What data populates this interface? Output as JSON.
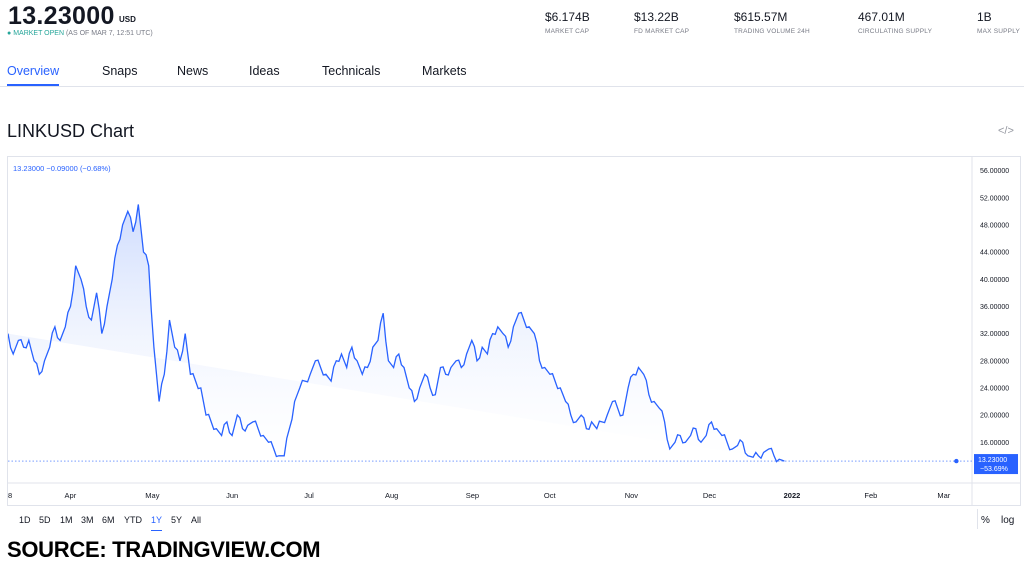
{
  "header": {
    "price": "13.23000",
    "currency": "USD",
    "status_dot": "●",
    "status_open": "MARKET OPEN",
    "status_time": "(AS OF MAR 7, 12:51 UTC)",
    "stats": [
      {
        "value": "$6.174B",
        "label": "MARKET CAP"
      },
      {
        "value": "$13.22B",
        "label": "FD MARKET CAP"
      },
      {
        "value": "$615.57M",
        "label": "TRADING VOLUME 24H"
      },
      {
        "value": "467.01M",
        "label": "CIRCULATING SUPPLY"
      },
      {
        "value": "1B",
        "label": "MAX SUPPLY"
      }
    ]
  },
  "tabs": [
    "Overview",
    "Snaps",
    "News",
    "Ideas",
    "Technicals",
    "Markets"
  ],
  "active_tab": "Overview",
  "chart_title": "LINKUSD Chart",
  "embed_icon": "code-icon",
  "embed_glyph": "</>",
  "chart_data": {
    "type": "area",
    "legend": "13.23000  −0.09000 (−0.68%)",
    "last_value_label": "13.23000",
    "last_change_label": "−53.69%",
    "line_color": "#2962ff",
    "fill_color": "#e3ebff",
    "ylim": [
      10,
      58
    ],
    "y_ticks": [
      "56.00000",
      "52.00000",
      "48.00000",
      "44.00000",
      "40.00000",
      "36.00000",
      "32.00000",
      "28.00000",
      "24.00000",
      "20.00000",
      "16.00000"
    ],
    "y_tick_values": [
      56,
      52,
      48,
      44,
      40,
      36,
      32,
      28,
      24,
      20,
      16
    ],
    "x_labels": [
      "8",
      "Apr",
      "May",
      "Jun",
      "Jul",
      "Aug",
      "Sep",
      "Oct",
      "Nov",
      "Dec",
      "2022",
      "Feb",
      "Mar"
    ],
    "x_label_positions_day": [
      0,
      24,
      55,
      86,
      116,
      147,
      178,
      208,
      239,
      269,
      300,
      331,
      359
    ],
    "x_range_day": [
      0,
      370
    ],
    "points_day": [
      0,
      2,
      4,
      6,
      8,
      10,
      12,
      14,
      16,
      18,
      20,
      22,
      24,
      26,
      28,
      30,
      32,
      34,
      36,
      38,
      40,
      42,
      44,
      46,
      48,
      50,
      52,
      54,
      56,
      58,
      60,
      62,
      64,
      66,
      68,
      70,
      72,
      74,
      76,
      78,
      80,
      82,
      84,
      86,
      88,
      90,
      92,
      94,
      96,
      98,
      100,
      102,
      104,
      106,
      108,
      110,
      112,
      114,
      116,
      118,
      120,
      122,
      124,
      126,
      128,
      130,
      132,
      134,
      136,
      138,
      140,
      142,
      144,
      146,
      148,
      150,
      152,
      154,
      156,
      158,
      160,
      162,
      164,
      166,
      168,
      170,
      172,
      174,
      176,
      178,
      180,
      182,
      184,
      186,
      188,
      190,
      192,
      194,
      196,
      198,
      200,
      202,
      204,
      206,
      208,
      210,
      212,
      214,
      216,
      218,
      220,
      222,
      224,
      226,
      228,
      230,
      232,
      234,
      236,
      238,
      240,
      242,
      244,
      246,
      248,
      250,
      252,
      254,
      256,
      258,
      260,
      262,
      264,
      266,
      268,
      270,
      272,
      274,
      276,
      278,
      280,
      282,
      284,
      286,
      288,
      290,
      292,
      294,
      296,
      298,
      300,
      302,
      304,
      306,
      308,
      310,
      312,
      314,
      316,
      318,
      320,
      322,
      324,
      326,
      328,
      330,
      332,
      334,
      336,
      338,
      340,
      342,
      344,
      346,
      348,
      350,
      352,
      354,
      356,
      358,
      360,
      362,
      364
    ],
    "points_value": [
      32,
      29,
      31,
      30,
      31,
      28,
      26,
      28,
      30,
      33,
      31,
      33,
      36,
      42,
      40,
      36,
      34,
      38,
      32,
      36,
      40,
      45,
      48,
      50,
      47,
      51,
      44,
      42,
      30,
      22,
      26,
      34,
      30,
      28,
      32,
      26,
      25,
      24,
      20,
      19,
      18,
      17,
      19,
      17,
      20,
      18,
      18.5,
      19,
      18,
      17,
      16,
      15,
      14,
      14,
      18,
      22,
      24,
      25,
      26,
      28,
      27,
      26,
      25,
      28,
      29,
      27,
      30,
      28,
      26,
      27,
      30,
      31,
      35,
      28,
      27,
      29,
      27,
      24,
      22,
      24,
      26,
      24,
      23,
      27,
      26,
      27,
      28,
      27,
      29,
      31,
      28,
      30,
      29,
      32,
      33,
      32,
      30,
      33,
      35,
      34,
      33,
      32,
      28,
      27,
      26,
      25,
      24,
      22,
      20,
      19,
      20,
      18,
      19,
      18,
      19,
      20,
      22,
      21,
      20,
      24,
      26,
      27,
      26,
      23,
      22,
      21,
      19,
      15,
      16,
      17,
      16,
      17,
      18,
      16,
      17,
      19,
      18,
      17,
      16,
      15,
      15.5,
      16,
      14,
      13.8,
      14,
      14.5,
      15,
      14,
      13.5,
      13.23
    ],
    "range_buttons": [
      "1D",
      "5D",
      "1M",
      "3M",
      "6M",
      "YTD",
      "1Y",
      "5Y",
      "All"
    ],
    "active_range": "1Y",
    "scale_options": [
      "%",
      "log"
    ]
  },
  "source_caption": "SOURCE: TRADINGVIEW.COM"
}
